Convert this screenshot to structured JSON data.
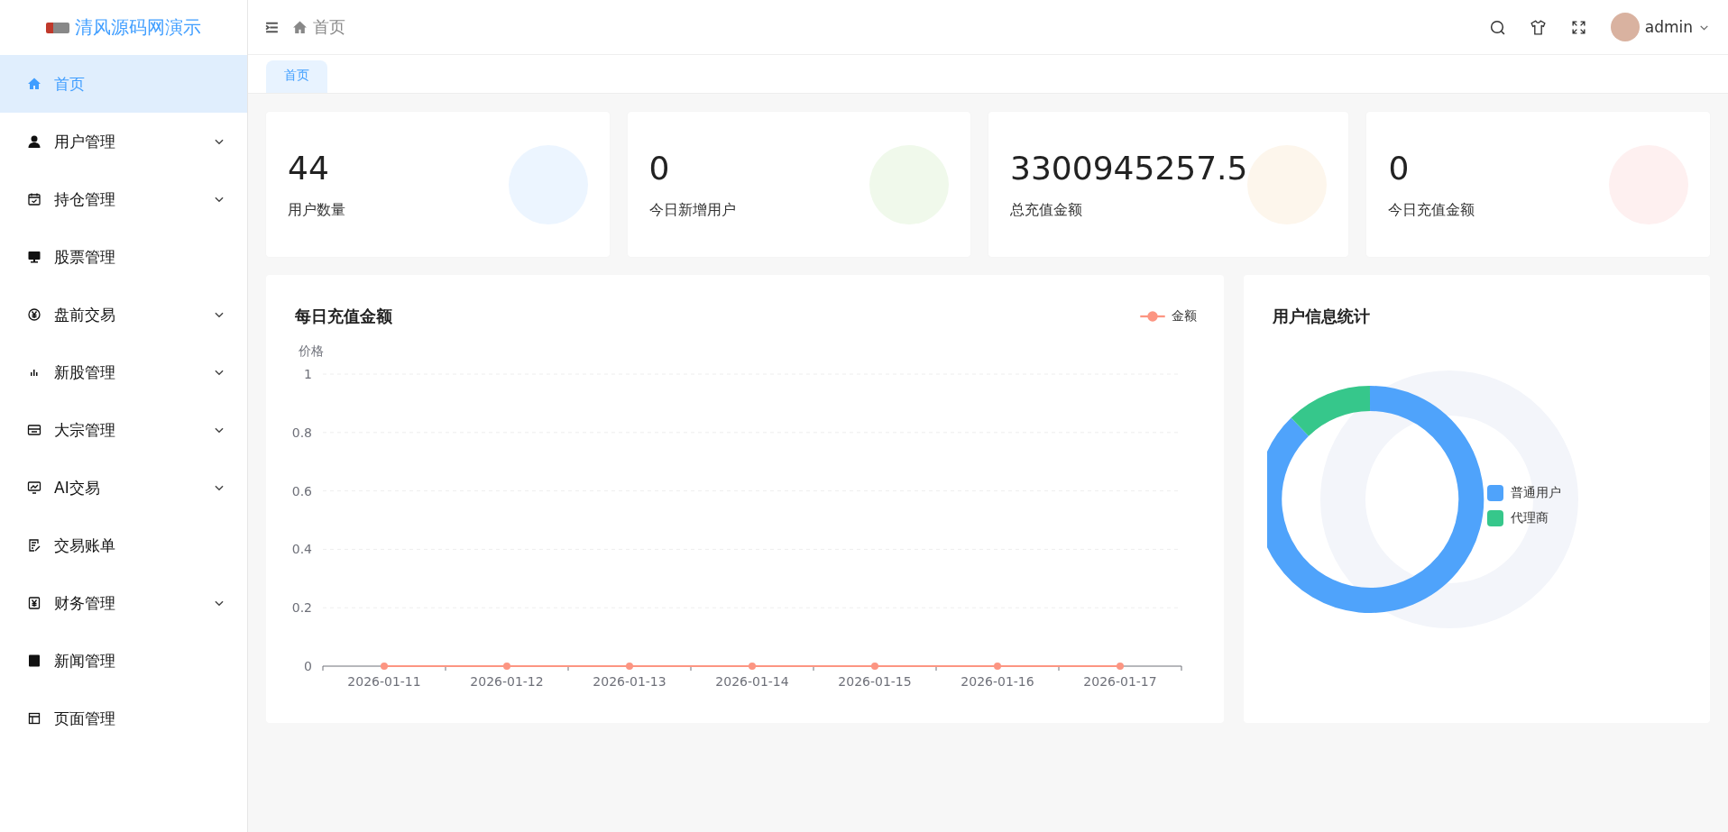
{
  "sidebar": {
    "logo_text": "清风源码网演示",
    "items": [
      {
        "label": "首页",
        "selected": true,
        "expandable": false
      },
      {
        "label": "用户管理",
        "selected": false,
        "expandable": true
      },
      {
        "label": "持仓管理",
        "selected": false,
        "expandable": true
      },
      {
        "label": "股票管理",
        "selected": false,
        "expandable": false
      },
      {
        "label": "盘前交易",
        "selected": false,
        "expandable": true
      },
      {
        "label": "新股管理",
        "selected": false,
        "expandable": true
      },
      {
        "label": "大宗管理",
        "selected": false,
        "expandable": true
      },
      {
        "label": "AI交易",
        "selected": false,
        "expandable": true
      },
      {
        "label": "交易账单",
        "selected": false,
        "expandable": false
      },
      {
        "label": "财务管理",
        "selected": false,
        "expandable": true
      },
      {
        "label": "新闻管理",
        "selected": false,
        "expandable": false
      },
      {
        "label": "页面管理",
        "selected": false,
        "expandable": false
      }
    ]
  },
  "header": {
    "breadcrumb": "首页",
    "user": "admin"
  },
  "tabs": [
    {
      "label": "首页",
      "selected": true
    }
  ],
  "stats": [
    {
      "value": "44",
      "label": "用户数量",
      "color": "#ecf5ff"
    },
    {
      "value": "0",
      "label": "今日新增用户",
      "color": "#f0f9eb"
    },
    {
      "value": "3300945257.5",
      "label": "总充值金额",
      "color": "#fdf6ec"
    },
    {
      "value": "0",
      "label": "今日充值金额",
      "color": "#fef0f0"
    }
  ],
  "recharge_chart": {
    "title": "每日充值金额",
    "chart_data": {
      "type": "line",
      "ylabel": "价格",
      "categories": [
        "2026-01-11",
        "2026-01-12",
        "2026-01-13",
        "2026-01-14",
        "2026-01-15",
        "2026-01-16",
        "2026-01-17"
      ],
      "ylim": [
        0,
        1
      ],
      "grid": true,
      "yticks": [
        0,
        0.2,
        0.4,
        0.6,
        0.8,
        1
      ],
      "series": [
        {
          "name": "金额",
          "color": "#fc9582",
          "marker": "circle",
          "values": [
            0,
            0,
            0,
            0,
            0,
            0,
            0
          ]
        }
      ]
    }
  },
  "user_chart": {
    "title": "用户信息统计",
    "legend": [
      {
        "label": "普通用户",
        "color": "#4fa3fb"
      },
      {
        "label": "代理商",
        "color": "#36c78b"
      }
    ]
  }
}
